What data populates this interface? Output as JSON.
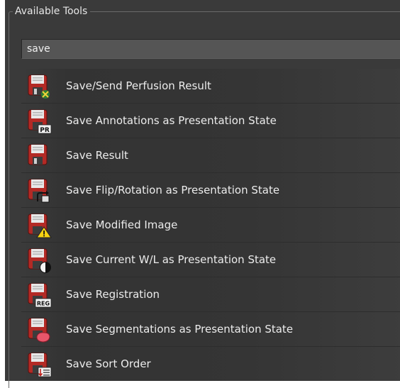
{
  "panel": {
    "title": "Available Tools"
  },
  "search": {
    "value": "save"
  },
  "tools": [
    {
      "label": "Save/Send Perfusion Result",
      "icon": "save-perfusion-icon"
    },
    {
      "label": "Save Annotations as Presentation State",
      "icon": "save-pr-icon",
      "badge": "PR"
    },
    {
      "label": "Save Result",
      "icon": "save-icon"
    },
    {
      "label": "Save Flip/Rotation as Presentation State",
      "icon": "save-flip-rotation-icon"
    },
    {
      "label": "Save Modified Image",
      "icon": "save-warning-icon"
    },
    {
      "label": "Save Current W/L as Presentation State",
      "icon": "save-window-level-icon"
    },
    {
      "label": "Save Registration",
      "icon": "save-registration-icon",
      "badge": "REG"
    },
    {
      "label": "Save Segmentations as Presentation State",
      "icon": "save-segmentation-icon"
    },
    {
      "label": "Save Sort Order",
      "icon": "save-sort-order-icon"
    }
  ]
}
